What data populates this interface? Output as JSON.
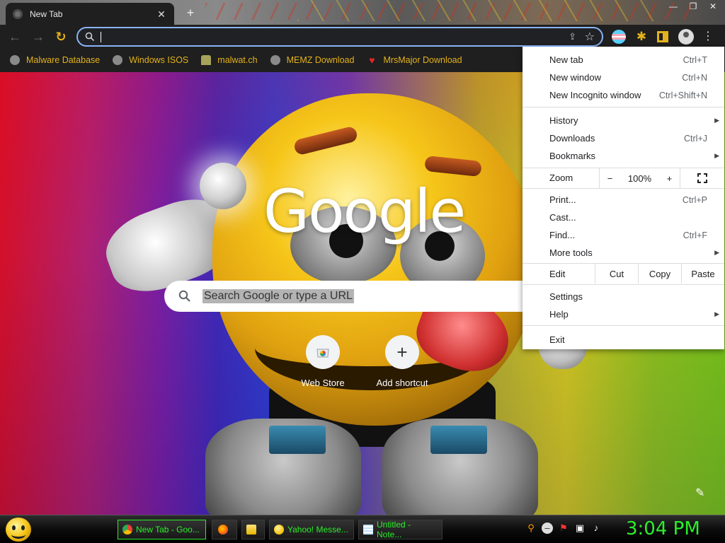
{
  "window": {
    "tab_title": "New Tab",
    "tab_close": "✕",
    "new_tab": "+",
    "controls": {
      "minimize": "—",
      "maximize": "❐",
      "close": "✕"
    }
  },
  "toolbar": {
    "back": "←",
    "forward": "→",
    "reload": "↻",
    "omnibox_value": "",
    "share": "⇪",
    "bookmark_star": "☆",
    "puzzle": "✱",
    "menu": "⋮"
  },
  "bookmarks": [
    {
      "label": "Malware Database",
      "icon": "globe-icon"
    },
    {
      "label": "Windows ISOS",
      "icon": "globe-icon"
    },
    {
      "label": "malwat.ch",
      "icon": "person-icon"
    },
    {
      "label": "MEMZ Download",
      "icon": "globe-icon"
    },
    {
      "label": "MrsMajor Download",
      "icon": "heart-icon"
    }
  ],
  "ntp": {
    "logo": "Google",
    "search_placeholder": "Search Google or type a URL",
    "shortcuts": [
      {
        "label": "Web Store",
        "icon": "web-store-icon"
      },
      {
        "label": "Add shortcut",
        "icon": "plus-icon",
        "glyph": "+"
      }
    ],
    "customize": "✎"
  },
  "menu": {
    "items": {
      "new_tab": {
        "label": "New tab",
        "shortcut": "Ctrl+T"
      },
      "new_window": {
        "label": "New window",
        "shortcut": "Ctrl+N"
      },
      "new_incognito": {
        "label": "New Incognito window",
        "shortcut": "Ctrl+Shift+N"
      },
      "history": {
        "label": "History"
      },
      "downloads": {
        "label": "Downloads",
        "shortcut": "Ctrl+J"
      },
      "bookmarks": {
        "label": "Bookmarks"
      },
      "print": {
        "label": "Print...",
        "shortcut": "Ctrl+P"
      },
      "cast": {
        "label": "Cast..."
      },
      "find": {
        "label": "Find...",
        "shortcut": "Ctrl+F"
      },
      "more_tools": {
        "label": "More tools"
      },
      "settings": {
        "label": "Settings"
      },
      "help": {
        "label": "Help"
      },
      "exit": {
        "label": "Exit"
      }
    },
    "submenu_arrow": "▶",
    "zoom": {
      "label": "Zoom",
      "minus": "−",
      "value": "100%",
      "plus": "+"
    },
    "edit": {
      "label": "Edit",
      "cut": "Cut",
      "copy": "Copy",
      "paste": "Paste"
    }
  },
  "taskbar": {
    "tasks": [
      {
        "label": "New Tab - Goo...",
        "icon": "chrome-icon"
      },
      {
        "label": "",
        "icon": "firefox-icon"
      },
      {
        "label": "",
        "icon": "folder-icon"
      },
      {
        "label": "Yahoo! Messe...",
        "icon": "yahoo-messenger-icon"
      },
      {
        "label": "Untitled - Note...",
        "icon": "notepad-icon"
      }
    ],
    "tray_icons": [
      "search-icon",
      "msn-icon",
      "security-flag-icon",
      "network-icon",
      "volume-icon"
    ],
    "clock": "3:04 PM"
  },
  "colors": {
    "accent_gold": "#e3b21c",
    "clock_green": "#2bef2b",
    "omnibox_border": "#8ab4f8",
    "chrome_dark": "#1f1f1f"
  }
}
